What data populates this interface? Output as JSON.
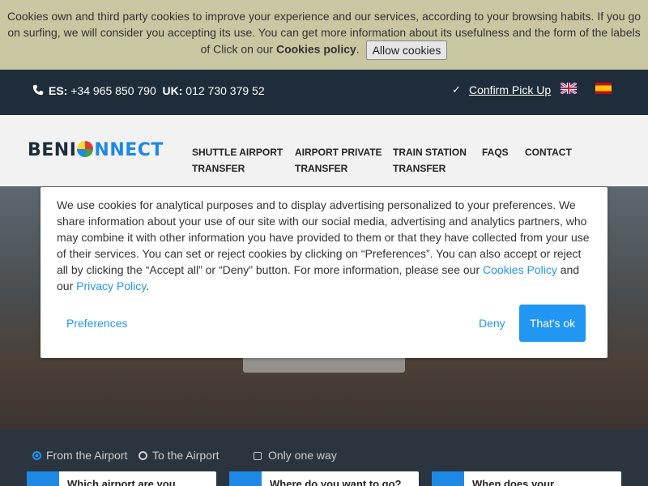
{
  "cookie_bar": {
    "text_1": "Cookies own and third party cookies to improve your experience and our services, according to your browsing habits. If you go on surfing, we will consider you accepting its use. You can get more information about its usefulness and the form of the labels of Click on our ",
    "policy_label": "Cookies policy",
    "text_2": ".",
    "allow_label": "Allow cookies"
  },
  "contact": {
    "es_label": "ES:",
    "es_phone": "+34 965 850 790",
    "uk_label": "UK:",
    "uk_phone": "012 730 379 52",
    "confirm_label": "Confirm Pick Up"
  },
  "nav": {
    "logo_a": "BENI",
    "logo_b": "NNECT",
    "items": [
      {
        "line1": "SHUTTLE AIRPORT",
        "line2": "TRANSFER"
      },
      {
        "line1": "AIRPORT PRIVATE",
        "line2": "TRANSFER"
      },
      {
        "line1": "TRAIN STATION",
        "line2": "TRANSFER"
      },
      {
        "line1": "FAQS",
        "line2": ""
      },
      {
        "line1": "CONTACT",
        "line2": ""
      }
    ]
  },
  "modal": {
    "text_1": "We use cookies for analytical purposes and to display advertising personalized to your preferences. We share information about your use of our site with our social media, advertising and analytics partners, who may combine it with other information you have provided to them or that they have collected from your use of their services. You can set or reject cookies by clicking on “Preferences”. You can also accept or reject all by clicking the “Accept all” or “Deny” button. For more information, please see our ",
    "cookies_link": "Cookies Policy",
    "text_2": " and our ",
    "privacy_link": "Privacy Policy",
    "text_3": ".",
    "preferences_label": "Preferences",
    "deny_label": "Deny",
    "ok_label": "That's ok"
  },
  "booking": {
    "from_label": "From the Airport",
    "to_label": "To the Airport",
    "oneway_label": "Only one way",
    "field_1": "Which airport are you",
    "field_2": "Where do you want to go?",
    "field_3": "When does your"
  },
  "colors": {
    "accent": "#2196f3",
    "dark_bar": "#1f2d3b",
    "cookie_bar": "#c9c6a2"
  }
}
